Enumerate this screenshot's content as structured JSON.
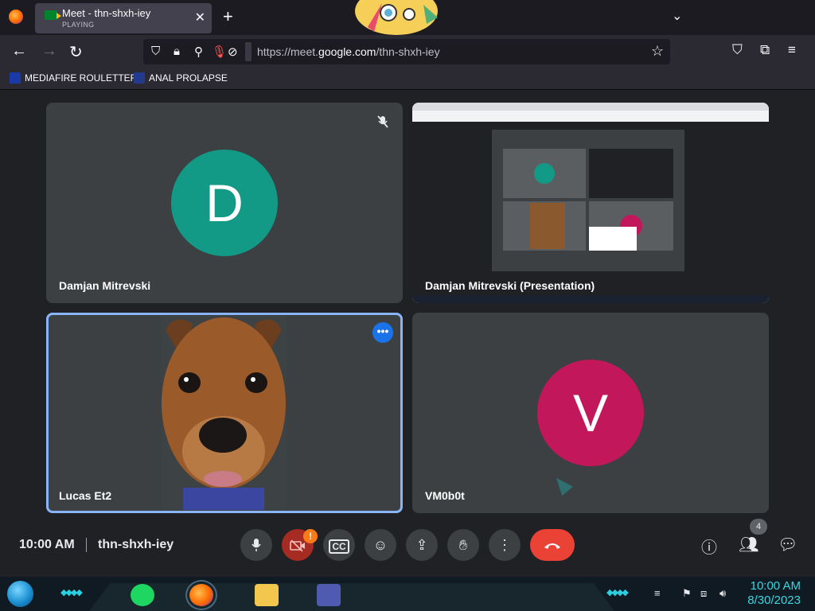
{
  "browser": {
    "tab": {
      "title": "Meet - thn-shxh-iey",
      "status": "PLAYING"
    },
    "url": {
      "prefix": "https://meet.",
      "domain": "google.com",
      "path": "/thn-shxh-iey"
    },
    "bookmarks": [
      {
        "label": "MEDIAFIRE ROULETTER"
      },
      {
        "label": "ANAL PROLAPSE"
      }
    ]
  },
  "meeting": {
    "participants": [
      {
        "name": "Damjan Mitrevski",
        "initial": "D",
        "avatar_color": "#129a86",
        "muted": true
      },
      {
        "name": "Damjan Mitrevski (Presentation)"
      },
      {
        "name": "Lucas Et2",
        "video": "dog-face-camera",
        "active_speaker": true
      },
      {
        "name": "VM0b0t",
        "initial": "V",
        "avatar_color": "#c2185b"
      }
    ],
    "bottom_bar": {
      "time": "10:00 AM",
      "meeting_code": "thn-shxh-iey",
      "participant_count": "4"
    },
    "controls": [
      "mic-icon",
      "camera-off-icon",
      "captions-icon",
      "emoji-icon",
      "present-icon",
      "hand-icon",
      "more-icon",
      "leave-call-icon"
    ],
    "right_controls": [
      "info-icon",
      "people-icon",
      "chat-icon"
    ]
  },
  "taskbar": {
    "time": "10:00 AM",
    "date": "8/30/2023"
  }
}
